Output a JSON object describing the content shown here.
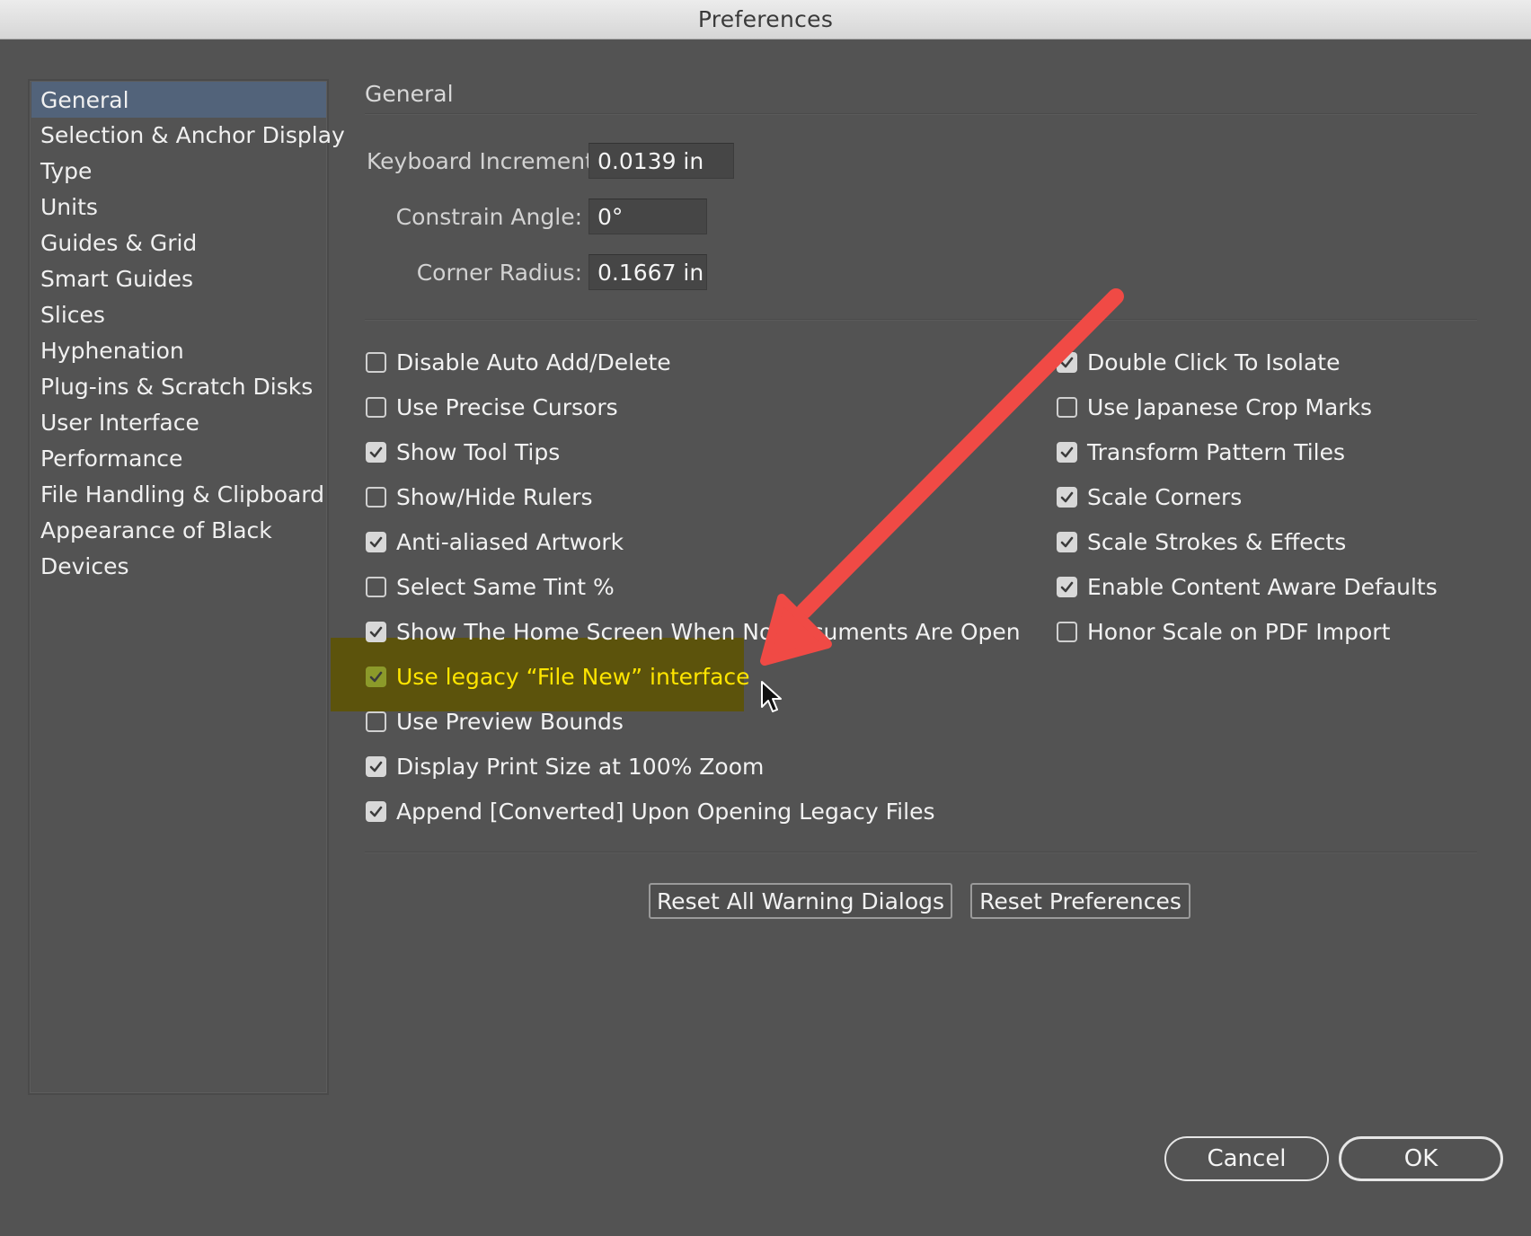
{
  "window": {
    "title": "Preferences"
  },
  "sidebar": {
    "items": [
      {
        "label": "General",
        "selected": true
      },
      {
        "label": "Selection & Anchor Display"
      },
      {
        "label": "Type"
      },
      {
        "label": "Units"
      },
      {
        "label": "Guides & Grid"
      },
      {
        "label": "Smart Guides"
      },
      {
        "label": "Slices"
      },
      {
        "label": "Hyphenation"
      },
      {
        "label": "Plug-ins & Scratch Disks"
      },
      {
        "label": "User Interface"
      },
      {
        "label": "Performance"
      },
      {
        "label": "File Handling & Clipboard"
      },
      {
        "label": "Appearance of Black"
      },
      {
        "label": "Devices"
      }
    ]
  },
  "panel": {
    "title": "General",
    "fields": [
      {
        "label": "Keyboard Increment:",
        "value": "0.0139 in"
      },
      {
        "label": "Constrain Angle:",
        "value": "0°"
      },
      {
        "label": "Corner Radius:",
        "value": "0.1667 in"
      }
    ],
    "left_options": [
      {
        "label": "Disable Auto Add/Delete",
        "checked": false
      },
      {
        "label": "Use Precise Cursors",
        "checked": false
      },
      {
        "label": "Show Tool Tips",
        "checked": true
      },
      {
        "label": "Show/Hide Rulers",
        "checked": false
      },
      {
        "label": "Anti-aliased Artwork",
        "checked": true
      },
      {
        "label": "Select Same Tint %",
        "checked": false
      },
      {
        "label": "Show The Home Screen When No Documents Are Open",
        "checked": true
      },
      {
        "label": "Use legacy “File New” interface",
        "checked": true,
        "highlighted": true
      },
      {
        "label": "Use Preview Bounds",
        "checked": false
      },
      {
        "label": "Display Print Size at 100% Zoom",
        "checked": true
      },
      {
        "label": "Append [Converted] Upon Opening Legacy Files",
        "checked": true
      }
    ],
    "right_options": [
      {
        "label": "Double Click To Isolate",
        "checked": true
      },
      {
        "label": "Use Japanese Crop Marks",
        "checked": false
      },
      {
        "label": "Transform Pattern Tiles",
        "checked": true
      },
      {
        "label": "Scale Corners",
        "checked": true
      },
      {
        "label": "Scale Strokes & Effects",
        "checked": true
      },
      {
        "label": "Enable Content Aware Defaults",
        "checked": true
      },
      {
        "label": "Honor Scale on PDF Import",
        "checked": false
      }
    ],
    "reset_warnings_label": "Reset All Warning Dialogs",
    "reset_prefs_label": "Reset Preferences"
  },
  "footer": {
    "cancel_label": "Cancel",
    "ok_label": "OK"
  },
  "colors": {
    "background": "#535353",
    "selected_item": "#52637a",
    "highlight": "#5e5400",
    "highlight_text": "#ffe500",
    "annotation_arrow": "#f04a45"
  },
  "icons": [
    "checkmark-icon",
    "annotation-arrow-icon",
    "mouse-pointer-icon"
  ]
}
